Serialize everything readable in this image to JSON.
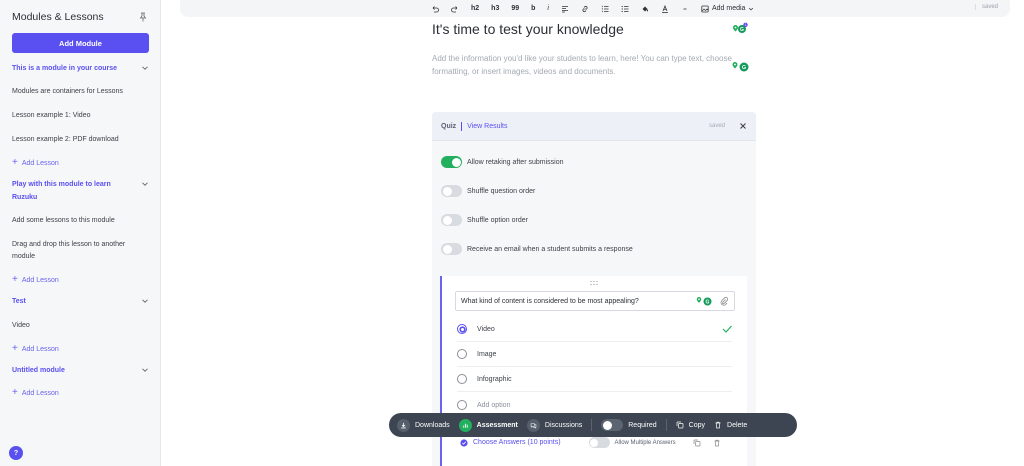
{
  "sidebar": {
    "title": "Modules & Lessons",
    "add_module": "Add Module",
    "modules": [
      {
        "title": "This is a module in your course",
        "lessons": [
          "Modules are containers for Lessons",
          "Lesson example 1: Video",
          "Lesson example 2: PDF download"
        ],
        "add_lesson": "Add Lesson"
      },
      {
        "title": "Play with this module to learn Ruzuku",
        "lessons": [
          "Add some lessons to this module",
          "Drag and drop this lesson to another module"
        ],
        "add_lesson": "Add Lesson"
      },
      {
        "title": "Test",
        "lessons": [
          "Video"
        ],
        "add_lesson": "Add Lesson"
      },
      {
        "title": "Untitled module",
        "lessons": [],
        "add_lesson": "Add Lesson"
      }
    ],
    "help": "?"
  },
  "toolbar": {
    "h2": "h2",
    "h3": "h3",
    "quote": "99",
    "bold": "b",
    "italic": "i",
    "add_media": "Add media",
    "saved": "saved"
  },
  "content": {
    "title": "It's time to test your knowledge",
    "intro": "Add the information you'd like your students to learn, here! You can type text, choose formatting, or insert images, videos and documents.",
    "ai_badge_count": "1"
  },
  "quiz": {
    "label": "Quiz",
    "view_results": "View Results",
    "saved": "saved",
    "options": [
      {
        "label": "Allow retaking after submission",
        "on": true
      },
      {
        "label": "Shuffle question order",
        "on": false
      },
      {
        "label": "Shuffle option order",
        "on": false
      },
      {
        "label": "Receive an email when a student submits a response",
        "on": false
      }
    ],
    "question": "What kind of content is considered to be most appealing?",
    "answers": [
      {
        "label": "Video",
        "selected": true,
        "correct": true
      },
      {
        "label": "Image",
        "selected": false,
        "correct": false
      },
      {
        "label": "Infographic",
        "selected": false,
        "correct": false
      }
    ],
    "add_option": "Add option",
    "choose_answers": "Choose Answers (10 points)",
    "allow_multiple": "Allow Multiple Answers"
  },
  "floatbar": {
    "downloads": "Downloads",
    "assessment": "Assessment",
    "discussions": "Discussions",
    "required": "Required",
    "copy": "Copy",
    "delete": "Delete"
  },
  "colors": {
    "accent": "#5a4ff0",
    "green": "#23b05e",
    "floatbar": "#3c4551"
  }
}
